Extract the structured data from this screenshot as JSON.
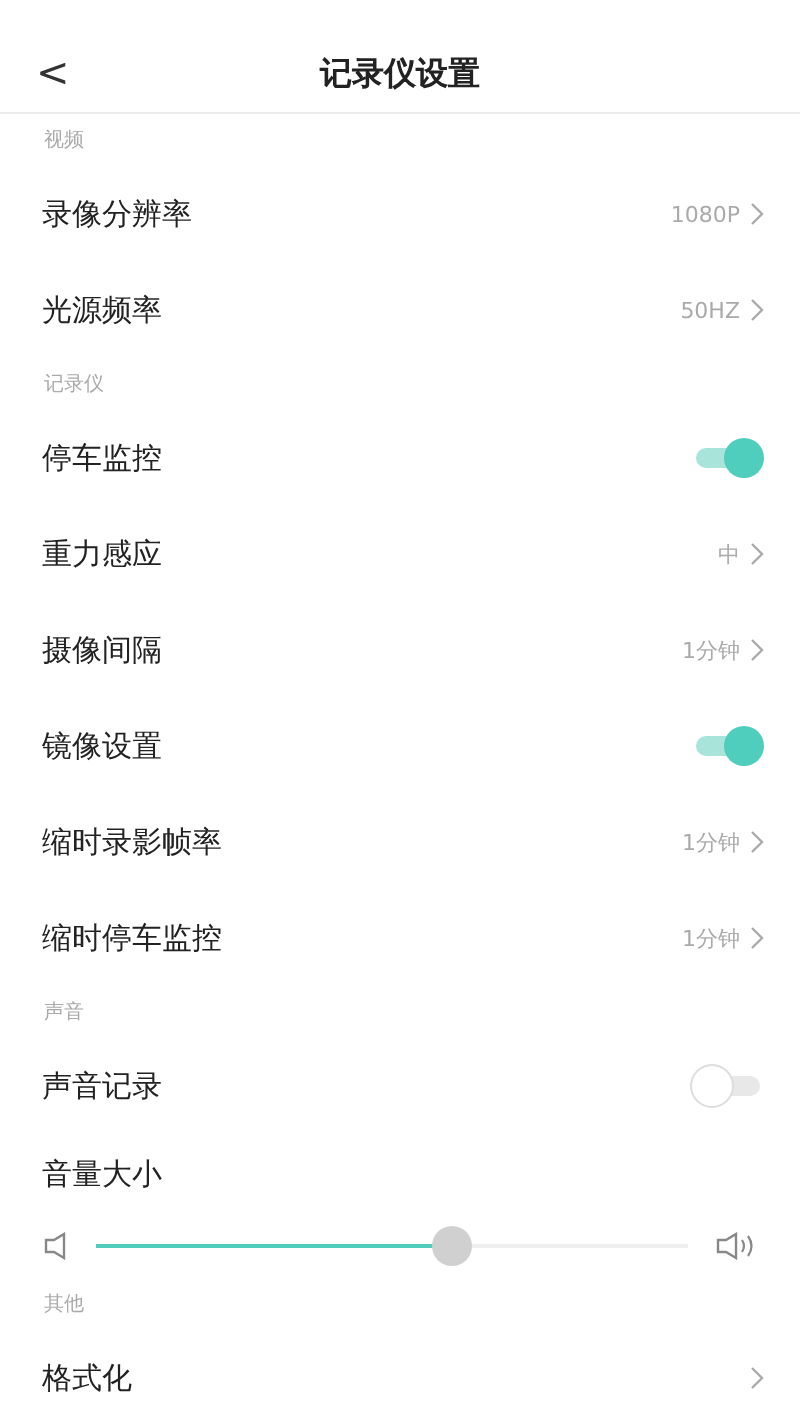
{
  "header": {
    "back": "<",
    "title": "记录仪设置"
  },
  "sections": [
    {
      "title": "视频",
      "rows": [
        {
          "kind": "value",
          "label": "录像分辨率",
          "value": "1080P"
        },
        {
          "kind": "value",
          "label": "光源频率",
          "value": "50HZ"
        }
      ]
    },
    {
      "title": "记录仪",
      "rows": [
        {
          "kind": "toggle",
          "label": "停车监控",
          "on": true
        },
        {
          "kind": "value",
          "label": "重力感应",
          "value": "中"
        },
        {
          "kind": "value",
          "label": "摄像间隔",
          "value": "1分钟"
        },
        {
          "kind": "toggle",
          "label": "镜像设置",
          "on": true
        },
        {
          "kind": "value",
          "label": "缩时录影帧率",
          "value": "1分钟"
        },
        {
          "kind": "value",
          "label": "缩时停车监控",
          "value": "1分钟"
        }
      ]
    },
    {
      "title": "声音",
      "rows": [
        {
          "kind": "toggle",
          "label": "声音记录",
          "on": false
        },
        {
          "kind": "slider",
          "label": "音量大小",
          "level": 0.6
        }
      ]
    },
    {
      "title": "其他",
      "rows": [
        {
          "kind": "link",
          "label": "格式化"
        }
      ]
    }
  ]
}
